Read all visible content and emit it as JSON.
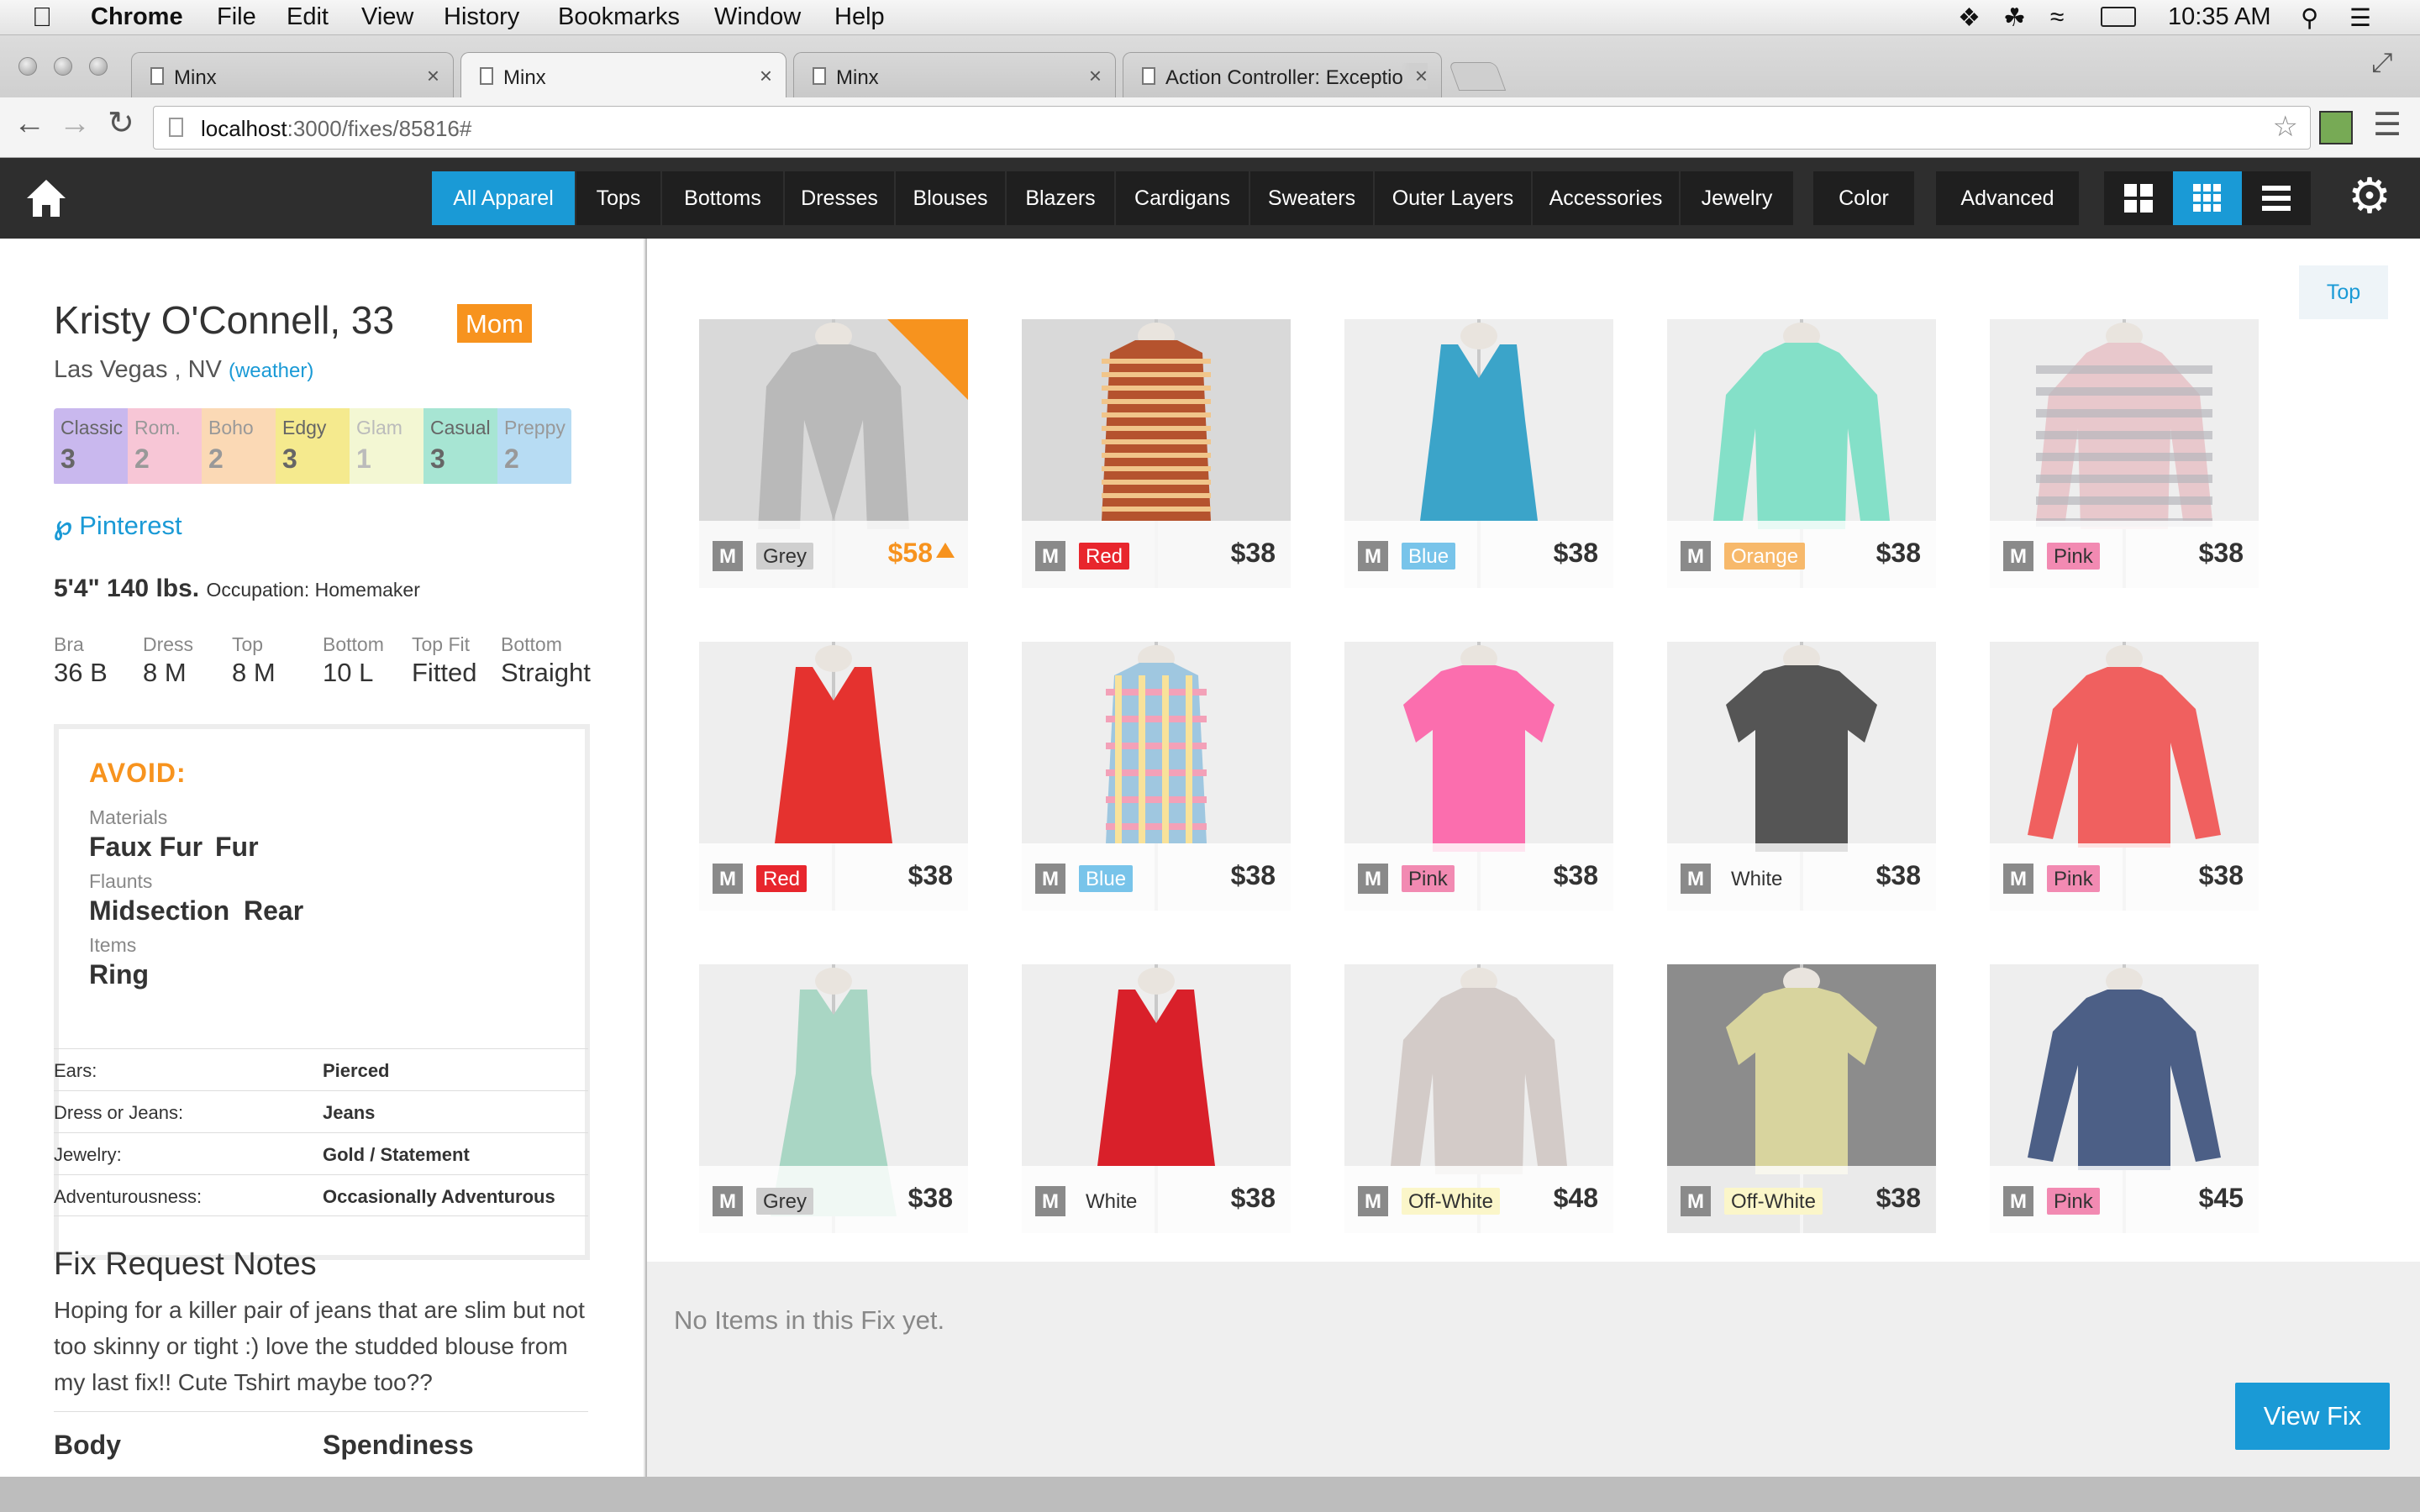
{
  "menubar": {
    "app": "Chrome",
    "items": [
      "File",
      "Edit",
      "View",
      "History",
      "Bookmarks",
      "Window",
      "Help"
    ],
    "clock": "10:35 AM"
  },
  "browser": {
    "tabs": [
      {
        "title": "Minx",
        "active": false
      },
      {
        "title": "Minx",
        "active": true
      },
      {
        "title": "Minx",
        "active": false
      },
      {
        "title": "Action Controller: Exceptio",
        "active": false
      }
    ],
    "url_host": "localhost",
    "url_path": ":3000/fixes/85816#"
  },
  "nav": {
    "categories": [
      "All Apparel",
      "Tops",
      "Bottoms",
      "Dresses",
      "Blouses",
      "Blazers",
      "Cardigans",
      "Sweaters",
      "Outer Layers",
      "Accessories",
      "Jewelry"
    ],
    "selected": "All Apparel",
    "color_label": "Color",
    "advanced_label": "Advanced",
    "view_modes": [
      "large-grid-icon",
      "small-grid-icon",
      "list-icon"
    ],
    "selected_view": "small-grid-icon"
  },
  "client": {
    "name": "Kristy O'Connell, 33",
    "badge": "Mom",
    "location": "Las Vegas , NV",
    "weather_link": "(weather)",
    "styles": [
      {
        "name": "Classic",
        "value": "3",
        "color": "#c9b8ee"
      },
      {
        "name": "Rom.",
        "value": "2",
        "color": "#f7c6d6"
      },
      {
        "name": "Boho",
        "value": "2",
        "color": "#fbd9b5"
      },
      {
        "name": "Edgy",
        "value": "3",
        "color": "#f5ea8e"
      },
      {
        "name": "Glam",
        "value": "1",
        "color": "#f3f7d3"
      },
      {
        "name": "Casual",
        "value": "3",
        "color": "#a7e5d3"
      },
      {
        "name": "Preppy",
        "value": "2",
        "color": "#b7dcf3"
      }
    ],
    "pinterest": "Pinterest",
    "height_weight": "5'4\" 140 lbs.",
    "occupation": "Occupation: Homemaker",
    "sizes": [
      {
        "label": "Bra",
        "value": "36 B"
      },
      {
        "label": "Dress",
        "value": "8 M"
      },
      {
        "label": "Top",
        "value": "8 M"
      },
      {
        "label": "Bottom",
        "value": "10 L"
      },
      {
        "label": "Top Fit",
        "value": "Fitted"
      },
      {
        "label": "Bottom",
        "value": "Straight"
      }
    ],
    "avoid": {
      "title": "AVOID:",
      "materials_label": "Materials",
      "materials": [
        "Faux Fur",
        "Fur"
      ],
      "flaunts_label": "Flaunts",
      "flaunts": [
        "Midsection",
        "Rear"
      ],
      "items_label": "Items",
      "items": [
        "Ring"
      ]
    },
    "prefs": [
      {
        "key": "Ears:",
        "value": "Pierced"
      },
      {
        "key": "Dress or Jeans:",
        "value": "Jeans"
      },
      {
        "key": "Jewelry:",
        "value": "Gold / Statement"
      },
      {
        "key": "Adventurousness:",
        "value": "Occasionally Adventurous"
      }
    ],
    "notes_title": "Fix Request Notes",
    "notes": "Hoping for a killer pair of jeans that are slim but not too skinny or tight :) love the studded blouse from my last fix!! Cute Tshirt maybe too??",
    "bottom_labels": [
      "Body",
      "Spendiness"
    ]
  },
  "top_button": "Top",
  "products": [
    {
      "size": "M",
      "color": "Grey",
      "color_bg": "#cfcfcf",
      "color_fg": "#333",
      "price": "$58",
      "highlight": true,
      "garment": "#b9b9b9",
      "kind": "blazer"
    },
    {
      "size": "M",
      "color": "Red",
      "color_bg": "#e8262d",
      "color_fg": "#fff",
      "price": "$38",
      "garment": "#b5532e",
      "kind": "stripe-top"
    },
    {
      "size": "M",
      "color": "Blue",
      "color_bg": "#78c4ea",
      "color_fg": "#fff",
      "price": "$38",
      "garment": "#3ba4c9",
      "kind": "tank"
    },
    {
      "size": "M",
      "color": "Orange",
      "color_bg": "#f7b96b",
      "color_fg": "#fff",
      "price": "$38",
      "garment": "#84e0c8",
      "kind": "cardigan"
    },
    {
      "size": "M",
      "color": "Pink",
      "color_bg": "#f28ab2",
      "color_fg": "#333",
      "price": "$38",
      "garment": "#e8c8cc",
      "kind": "stripe-sweater"
    },
    {
      "size": "M",
      "color": "Red",
      "color_bg": "#e8262d",
      "color_fg": "#fff",
      "price": "$38",
      "garment": "#e5322f",
      "kind": "tank"
    },
    {
      "size": "M",
      "color": "Blue",
      "color_bg": "#78c4ea",
      "color_fg": "#fff",
      "price": "$38",
      "garment": "#9fc7e0",
      "kind": "plaid"
    },
    {
      "size": "M",
      "color": "Pink",
      "color_bg": "#f28ab2",
      "color_fg": "#333",
      "price": "$38",
      "garment": "#fb6eae",
      "kind": "tee"
    },
    {
      "size": "M",
      "color": "White",
      "color_bg": "transparent",
      "color_fg": "#333",
      "price": "$38",
      "garment": "#555555",
      "kind": "tee"
    },
    {
      "size": "M",
      "color": "Pink",
      "color_bg": "#f28ab2",
      "color_fg": "#333",
      "price": "$38",
      "garment": "#f0605f",
      "kind": "longsleeve"
    },
    {
      "size": "M",
      "color": "Grey",
      "color_bg": "#cfcfcf",
      "color_fg": "#333",
      "price": "$38",
      "garment": "#a9d6c4",
      "kind": "dress"
    },
    {
      "size": "M",
      "color": "White",
      "color_bg": "transparent",
      "color_fg": "#333",
      "price": "$38",
      "garment": "#d9202a",
      "kind": "tank"
    },
    {
      "size": "M",
      "color": "Off-White",
      "color_bg": "#fbf6c9",
      "color_fg": "#333",
      "price": "$48",
      "garment": "#d3cbc8",
      "kind": "cardigan"
    },
    {
      "size": "M",
      "color": "Off-White",
      "color_bg": "#fbf6c9",
      "color_fg": "#333",
      "price": "$38",
      "garment": "#d8d49e",
      "kind": "tee"
    },
    {
      "size": "M",
      "color": "Pink",
      "color_bg": "#f28ab2",
      "color_fg": "#333",
      "price": "$45",
      "garment": "#4c5f86",
      "kind": "longsleeve"
    }
  ],
  "fix": {
    "empty_text": "No Items in this Fix yet.",
    "view_button": "View Fix"
  },
  "colors": {
    "accent": "#1a9ad6",
    "nav_bg": "#2e2e2e",
    "badge_orange": "#f7931e"
  }
}
